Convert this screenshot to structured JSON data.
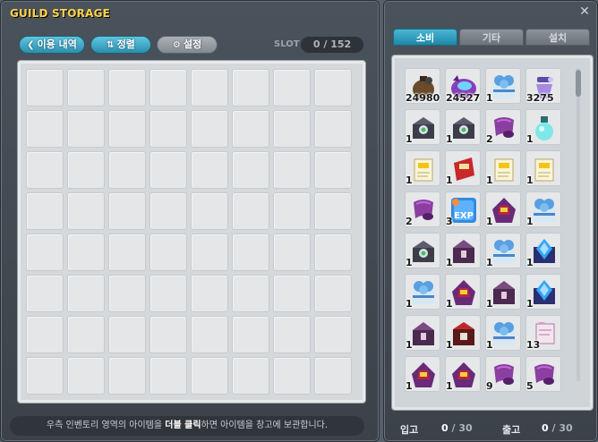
{
  "storage": {
    "title": "GUILD STORAGE",
    "toolbar": {
      "history_label": "이용 내역",
      "sort_label": "정렬",
      "settings_label": "설정"
    },
    "slot": {
      "label": "SLOT",
      "used": "0",
      "capacity": "/ 152"
    },
    "grid": {
      "columns": 8,
      "rows": 8
    },
    "hint": {
      "before": "우측 인벤토리 영역의 아이템을 ",
      "emphasis": "더블 클릭",
      "after": "하면 아이템을 창고에 보관합니다."
    }
  },
  "inventory": {
    "tabs": [
      {
        "label": "소비",
        "active": true
      },
      {
        "label": "기타",
        "active": false
      },
      {
        "label": "설치",
        "active": false
      }
    ],
    "items": [
      {
        "icon": "brown-pouch-icon",
        "qty": "24980"
      },
      {
        "icon": "purple-creature-icon",
        "qty": "24527"
      },
      {
        "icon": "blue-gift-box-icon",
        "qty": "1"
      },
      {
        "icon": "purple-potion-icon",
        "qty": "3275"
      },
      {
        "icon": "dark-chest-icon",
        "qty": "1"
      },
      {
        "icon": "dark-chest-icon",
        "qty": "1"
      },
      {
        "icon": "purple-scroll-icon",
        "qty": "2"
      },
      {
        "icon": "blue-potion-flask-icon",
        "qty": "1"
      },
      {
        "icon": "yellow-scroll-icon",
        "qty": "1"
      },
      {
        "icon": "red-scroll-icon",
        "qty": "1"
      },
      {
        "icon": "yellow-scroll-icon",
        "qty": "1"
      },
      {
        "icon": "yellow-scroll-icon",
        "qty": "1"
      },
      {
        "icon": "purple-scroll-icon",
        "qty": "2"
      },
      {
        "icon": "exp-coupon-icon",
        "qty": "3"
      },
      {
        "icon": "hooded-figure-icon",
        "qty": "1"
      },
      {
        "icon": "blue-gift-box-icon",
        "qty": "1"
      },
      {
        "icon": "dark-chest-icon",
        "qty": "1"
      },
      {
        "icon": "purple-chest-icon",
        "qty": "1"
      },
      {
        "icon": "blue-gift-box-icon",
        "qty": "1"
      },
      {
        "icon": "blue-crystal-chest-icon",
        "qty": "1"
      },
      {
        "icon": "blue-gift-box-icon",
        "qty": "1"
      },
      {
        "icon": "hooded-figure-icon",
        "qty": "1"
      },
      {
        "icon": "purple-chest-icon",
        "qty": "1"
      },
      {
        "icon": "blue-crystal-chest-icon",
        "qty": "1"
      },
      {
        "icon": "purple-chest-icon",
        "qty": "1"
      },
      {
        "icon": "red-chest-icon",
        "qty": "1"
      },
      {
        "icon": "blue-gift-box-icon",
        "qty": "1"
      },
      {
        "icon": "pink-scroll-icon",
        "qty": "13"
      },
      {
        "icon": "hooded-figure-icon",
        "qty": "1"
      },
      {
        "icon": "hooded-figure-icon",
        "qty": "1"
      },
      {
        "icon": "purple-scroll-icon",
        "qty": "9"
      },
      {
        "icon": "purple-scroll-icon",
        "qty": "5"
      }
    ],
    "footer": {
      "deposit_label": "입고",
      "deposit_count": "0",
      "deposit_cap": "/ 30",
      "withdraw_label": "출고",
      "withdraw_count": "0",
      "withdraw_cap": "/ 30"
    }
  },
  "colors": {
    "title": "#ffd34a",
    "accent_button": "#2b8fae",
    "active_tab": "#1f87a8"
  }
}
